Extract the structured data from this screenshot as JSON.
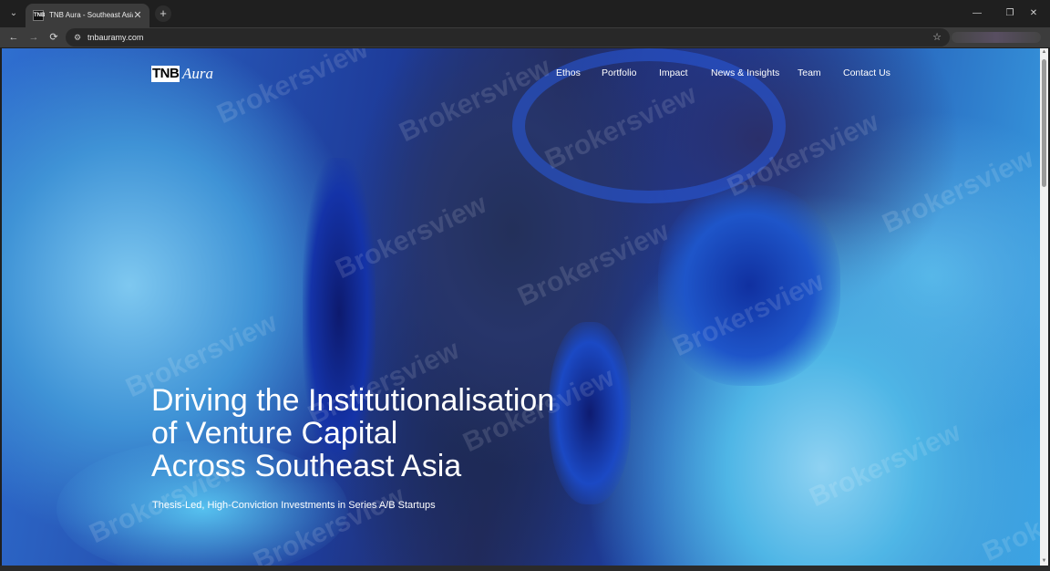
{
  "browser": {
    "tab_title": "TNB Aura - Southeast Asia Ea",
    "favicon_text": "TNB",
    "tab_close_glyph": "✕",
    "new_tab_glyph": "+",
    "tab_list_glyph": "⌄",
    "url": "tnbauramy.com",
    "icons": {
      "back": "←",
      "forward": "→",
      "reload": "⟳",
      "site_info": "⚙",
      "star": "☆",
      "minimize": "—",
      "restore": "❐",
      "close": "✕"
    }
  },
  "site": {
    "logo": {
      "tnb": "TNB",
      "aura": "Aura"
    },
    "nav": [
      "Ethos",
      "Portfolio",
      "Impact",
      "News & Insights",
      "Team",
      "Contact Us"
    ],
    "hero": {
      "title_lines": [
        "Driving the Institutionalisation",
        "of Venture Capital",
        "Across Southeast Asia"
      ],
      "subtitle": "Thesis-Led, High-Conviction Investments in Series A/B Startups"
    },
    "watermark": "Brokersview"
  },
  "colors": {
    "chrome_dark": "#1f1f1f",
    "toolbar": "#3c3c3c",
    "hero_text": "#ffffff",
    "ink_deep": "#1e3c9a",
    "ink_light": "#7ec8f0"
  }
}
